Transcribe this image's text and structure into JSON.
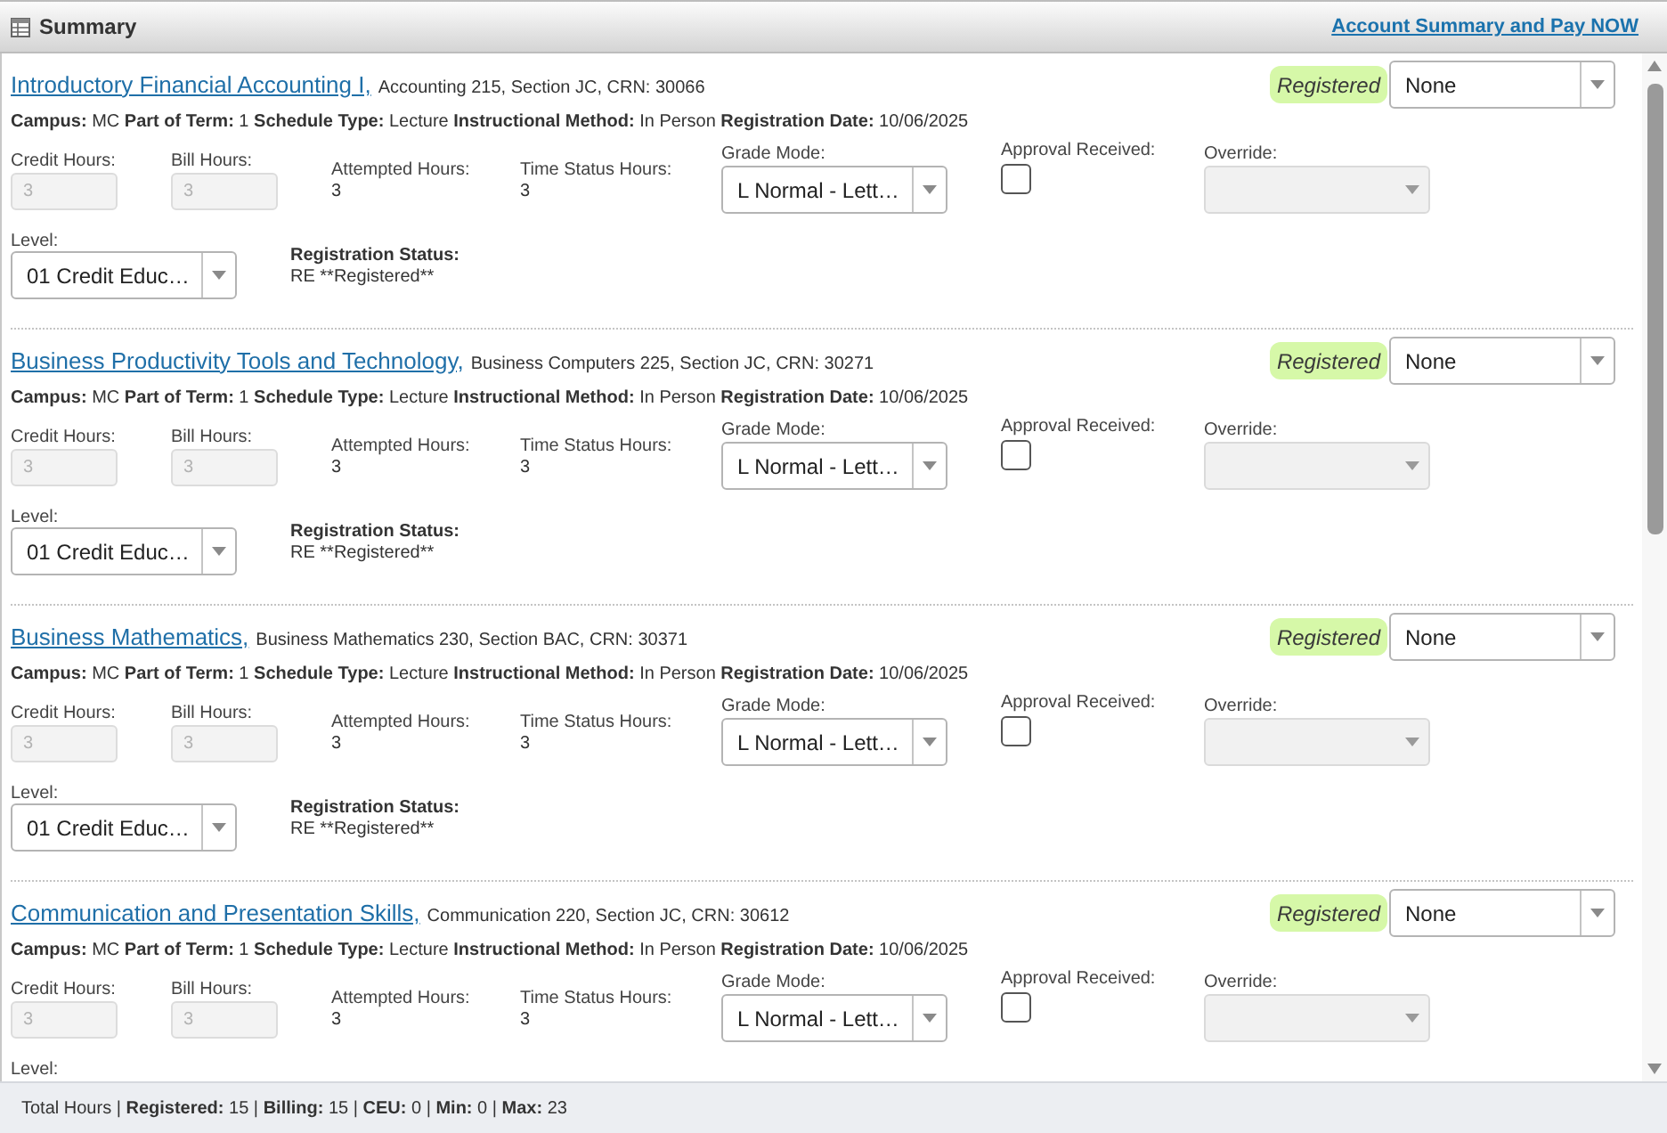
{
  "header": {
    "title": "Summary",
    "link": "Account Summary and Pay NOW"
  },
  "courses": [
    {
      "title": "Introductory Financial Accounting I,",
      "details": "Accounting 215, Section JC, CRN: 30066",
      "badge": "Registered",
      "action": "None",
      "info": "**Campus:** MC **Part of Term:** 1 **Schedule Type:** Lecture **Instructional Method:** In Person **Registration Date:** 10/06/2025",
      "credit_hours": {
        "label": "Credit Hours:",
        "value": "3",
        "disabled": true
      },
      "bill_hours": {
        "label": "Bill Hours:",
        "value": "3",
        "disabled": true
      },
      "attempted_hours": {
        "label": "Attempted Hours:",
        "value": "3"
      },
      "time_status_hours": {
        "label": "Time Status Hours:",
        "value": "3"
      },
      "grade_mode": {
        "label": "Grade Mode:",
        "value": "L Normal - Lett…"
      },
      "approval_received": {
        "label": "Approval Received:",
        "checked": false
      },
      "override": {
        "label": "Override:",
        "disabled": true
      },
      "level": {
        "label": "Level:",
        "value": "01 Credit Educ…"
      },
      "registration_status": {
        "label": "Registration Status:",
        "value": "RE **Registered**"
      }
    },
    {
      "title": "Business Productivity Tools and Technology,",
      "details": "Business Computers 225, Section JC, CRN: 30271",
      "badge": "Registered",
      "action": "None",
      "info": "**Campus:** MC **Part of Term:** 1 **Schedule Type:** Lecture **Instructional Method:** In Person **Registration Date:** 10/06/2025",
      "credit_hours": {
        "label": "Credit Hours:",
        "value": "3",
        "disabled": true
      },
      "bill_hours": {
        "label": "Bill Hours:",
        "value": "3",
        "disabled": true
      },
      "attempted_hours": {
        "label": "Attempted Hours:",
        "value": "3"
      },
      "time_status_hours": {
        "label": "Time Status Hours:",
        "value": "3"
      },
      "grade_mode": {
        "label": "Grade Mode:",
        "value": "L Normal - Lett…"
      },
      "approval_received": {
        "label": "Approval Received:",
        "checked": false
      },
      "override": {
        "label": "Override:",
        "disabled": true
      },
      "level": {
        "label": "Level:",
        "value": "01 Credit Educ…"
      },
      "registration_status": {
        "label": "Registration Status:",
        "value": "RE **Registered**"
      }
    },
    {
      "title": "Business Mathematics,",
      "details": "Business Mathematics 230, Section BAC, CRN: 30371",
      "badge": "Registered",
      "action": "None",
      "info": "**Campus:** MC **Part of Term:** 1 **Schedule Type:** Lecture **Instructional Method:** In Person **Registration Date:** 10/06/2025",
      "credit_hours": {
        "label": "Credit Hours:",
        "value": "3",
        "disabled": true
      },
      "bill_hours": {
        "label": "Bill Hours:",
        "value": "3",
        "disabled": true
      },
      "attempted_hours": {
        "label": "Attempted Hours:",
        "value": "3"
      },
      "time_status_hours": {
        "label": "Time Status Hours:",
        "value": "3"
      },
      "grade_mode": {
        "label": "Grade Mode:",
        "value": "L Normal - Lett…"
      },
      "approval_received": {
        "label": "Approval Received:",
        "checked": false
      },
      "override": {
        "label": "Override:",
        "disabled": true
      },
      "level": {
        "label": "Level:",
        "value": "01 Credit Educ…"
      },
      "registration_status": {
        "label": "Registration Status:",
        "value": "RE **Registered**"
      }
    },
    {
      "title": "Communication and Presentation Skills,",
      "details": "Communication 220, Section JC, CRN: 30612",
      "badge": "Registered",
      "action": "None",
      "info": "**Campus:** MC **Part of Term:** 1 **Schedule Type:** Lecture **Instructional Method:** In Person **Registration Date:** 10/06/2025",
      "credit_hours": {
        "label": "Credit Hours:",
        "value": "3",
        "disabled": true
      },
      "bill_hours": {
        "label": "Bill Hours:",
        "value": "3",
        "disabled": true
      },
      "attempted_hours": {
        "label": "Attempted Hours:",
        "value": "3"
      },
      "time_status_hours": {
        "label": "Time Status Hours:",
        "value": "3"
      },
      "grade_mode": {
        "label": "Grade Mode:",
        "value": "L Normal - Lett…"
      },
      "approval_received": {
        "label": "Approval Received:",
        "checked": false
      },
      "override": {
        "label": "Override:",
        "disabled": true
      },
      "level": {
        "label": "Level:"
      }
    }
  ],
  "footer": "Total Hours | **Registered:** 15 | **Billing:** 15 | **CEU:** 0 | **Min:** 0 | **Max:** 23"
}
